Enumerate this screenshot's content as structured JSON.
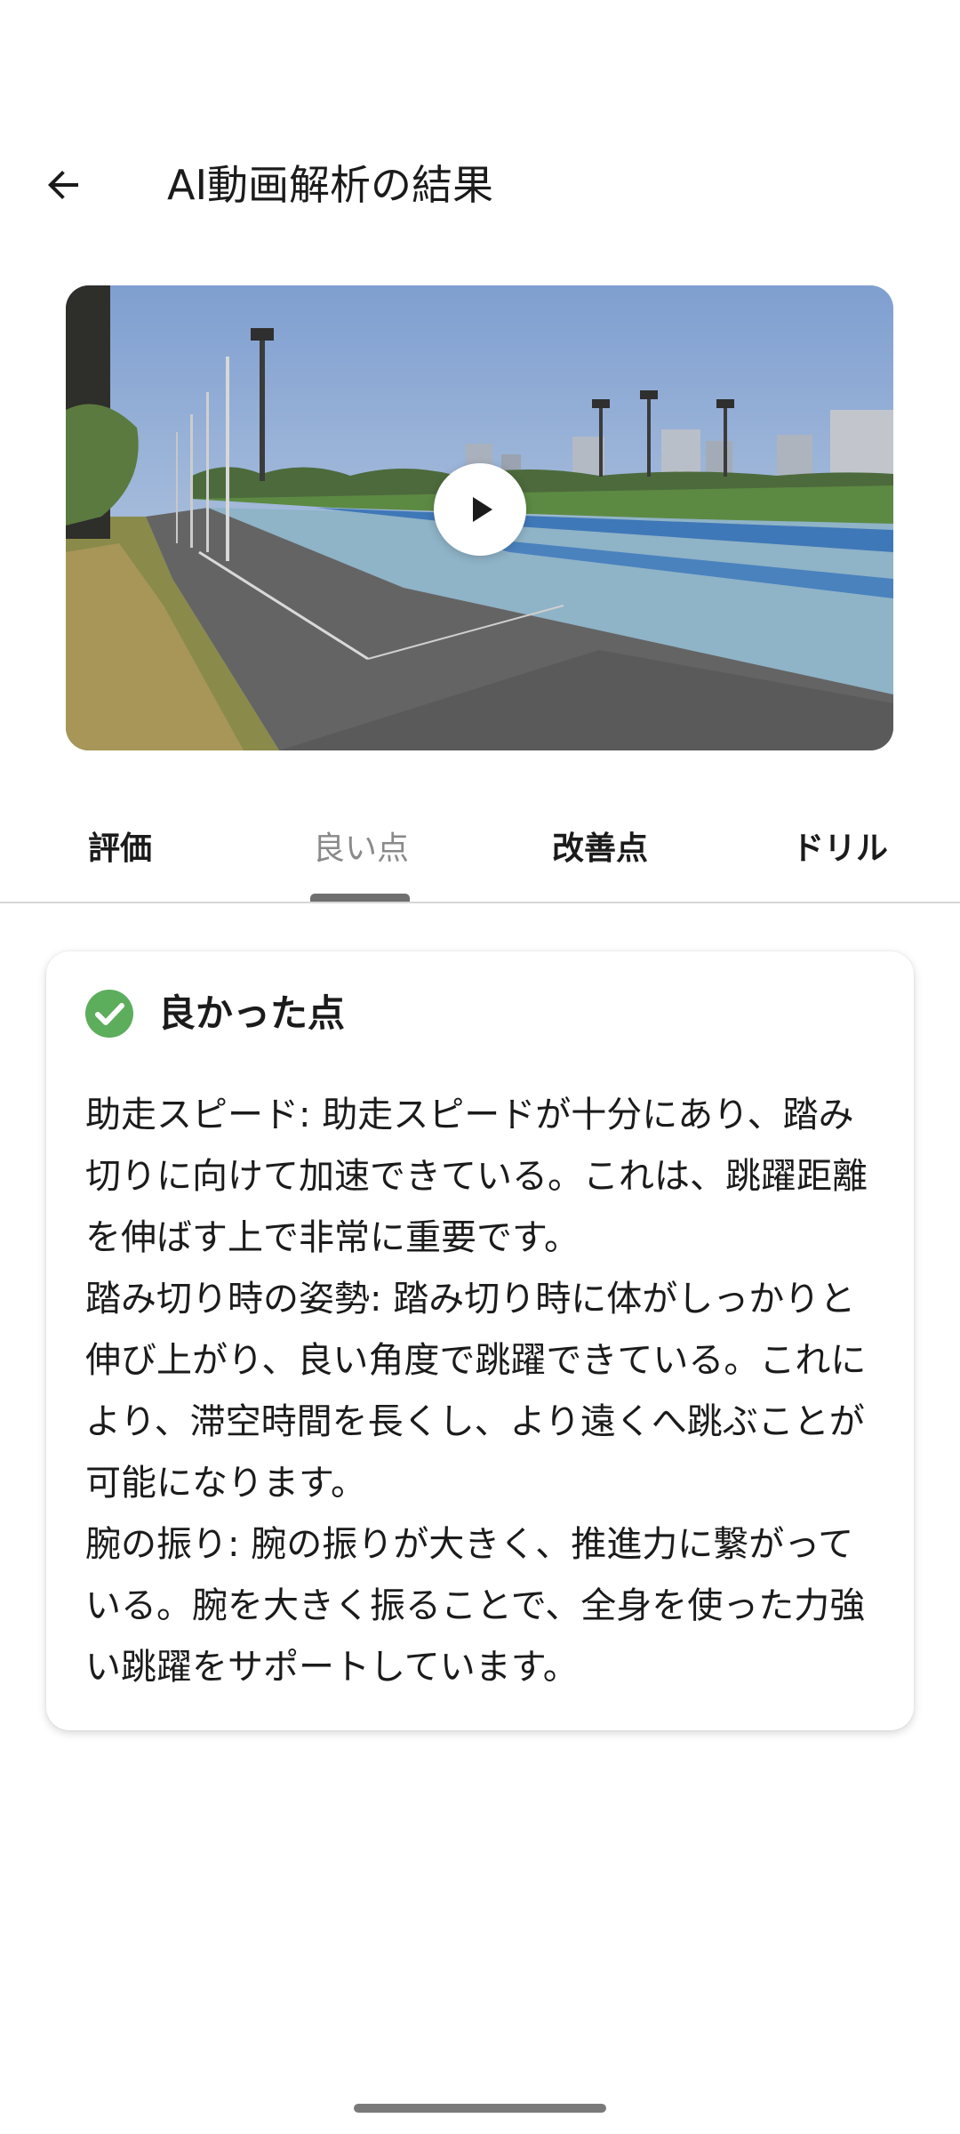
{
  "app_bar": {
    "title": "AI動画解析の結果",
    "back_icon": "arrow-back-icon"
  },
  "video": {
    "play_icon": "play-icon"
  },
  "tabs": [
    {
      "label": "評価",
      "active": false
    },
    {
      "label": "良い点",
      "active": true
    },
    {
      "label": "改善点",
      "active": false
    },
    {
      "label": "ドリル",
      "active": false
    }
  ],
  "card": {
    "title": "良かった点",
    "icon": "check-circle-icon",
    "icon_color": "#5cad5c",
    "paragraphs": [
      "助走スピード: 助走スピードが十分にあり、踏み切りに向けて加速できている。これは、跳躍距離を伸ばす上で非常に重要です。",
      "踏み切り時の姿勢: 踏み切り時に体がしっかりと伸び上がり、良い角度で跳躍できている。これにより、滞空時間を長くし、より遠くへ跳ぶことが可能になります。",
      "腕の振り: 腕の振りが大きく、推進力に繋がっている。腕を大きく振ることで、全身を使った力強い跳躍をサポートしています。"
    ]
  }
}
